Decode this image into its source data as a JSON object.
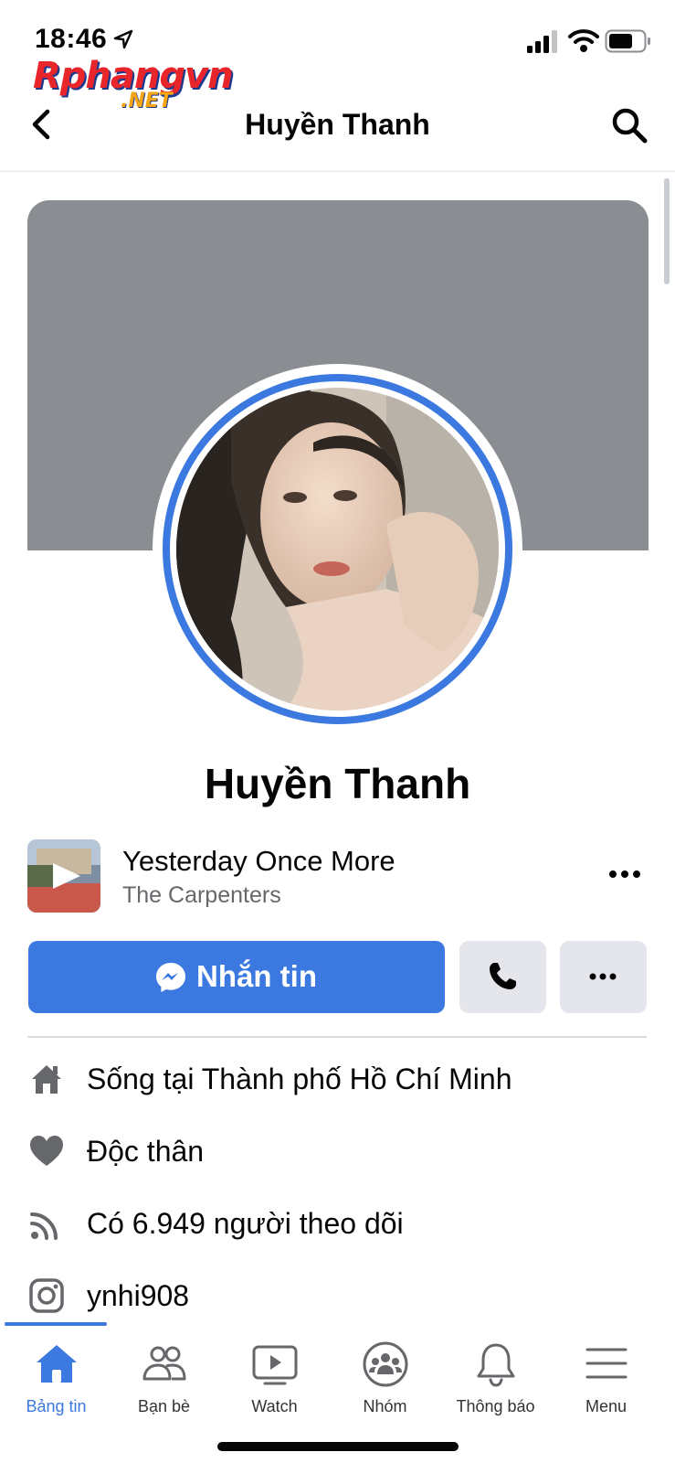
{
  "status_bar": {
    "time": "18:46"
  },
  "watermark": {
    "main": "Rphangvn",
    "sub": ".NET"
  },
  "header": {
    "title": "Huyền Thanh"
  },
  "profile": {
    "name": "Huyền Thanh"
  },
  "music": {
    "title": "Yesterday Once More",
    "artist": "The Carpenters"
  },
  "actions": {
    "message_label": "Nhắn tin"
  },
  "info": [
    {
      "icon": "home-icon",
      "text": "Sống tại Thành phố Hồ Chí Minh"
    },
    {
      "icon": "heart-icon",
      "text": "Độc thân"
    },
    {
      "icon": "rss-icon",
      "text": "Có 6.949 người theo dõi"
    },
    {
      "icon": "instagram-icon",
      "text": "ynhi908"
    }
  ],
  "tabs": [
    {
      "label": "Bảng tin",
      "icon": "home-icon",
      "active": true
    },
    {
      "label": "Bạn bè",
      "icon": "friends-icon",
      "active": false
    },
    {
      "label": "Watch",
      "icon": "watch-icon",
      "active": false
    },
    {
      "label": "Nhóm",
      "icon": "groups-icon",
      "active": false
    },
    {
      "label": "Thông báo",
      "icon": "bell-icon",
      "active": false
    },
    {
      "label": "Menu",
      "icon": "menu-icon",
      "active": false
    }
  ],
  "colors": {
    "accent": "#3b78e0",
    "cover": "#8a8d91",
    "secondary_button": "#e4e6eb",
    "secondary_text": "#65676b"
  }
}
